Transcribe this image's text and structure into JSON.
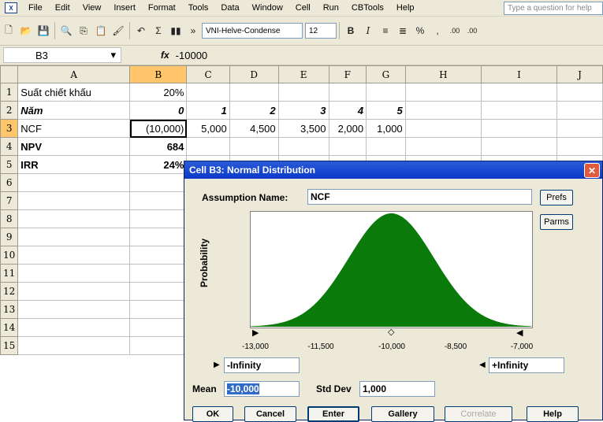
{
  "menubar": {
    "items": [
      "File",
      "Edit",
      "View",
      "Insert",
      "Format",
      "Tools",
      "Data",
      "Window",
      "Cell",
      "Run",
      "CBTools",
      "Help"
    ],
    "ask_placeholder": "Type a question for help"
  },
  "toolbar": {
    "font_name": "VNI-Helve-Condense",
    "font_size": "12",
    "bold": "B",
    "italic": "I",
    "percent": "%",
    "comma": ",",
    "inc_decimal": ".00",
    "dec_decimal": ".00"
  },
  "formula_bar": {
    "name_box": "B3",
    "fx": "fx",
    "value": "-10000"
  },
  "sheet": {
    "columns": [
      "A",
      "B",
      "C",
      "D",
      "E",
      "F",
      "G",
      "H",
      "I",
      "J"
    ],
    "rows": [
      {
        "n": "1",
        "cells": [
          "Suất chiết khấu",
          "20%",
          "",
          "",
          "",
          "",
          "",
          "",
          "",
          ""
        ]
      },
      {
        "n": "2",
        "cells": [
          "Năm",
          "0",
          "1",
          "2",
          "3",
          "4",
          "5",
          "",
          "",
          ""
        ]
      },
      {
        "n": "3",
        "cells": [
          "NCF",
          "(10,000)",
          "5,000",
          "4,500",
          "3,500",
          "2,000",
          "1,000",
          "",
          "",
          ""
        ]
      },
      {
        "n": "4",
        "cells": [
          "NPV",
          "684",
          "",
          "",
          "",
          "",
          "",
          "",
          "",
          ""
        ]
      },
      {
        "n": "5",
        "cells": [
          "IRR",
          "24%",
          "",
          "",
          "",
          "",
          "",
          "",
          "",
          ""
        ]
      },
      {
        "n": "6",
        "cells": [
          "",
          "",
          "",
          "",
          "",
          "",
          "",
          "",
          "",
          ""
        ]
      },
      {
        "n": "7",
        "cells": [
          "",
          "",
          "",
          "",
          "",
          "",
          "",
          "",
          "",
          ""
        ]
      },
      {
        "n": "8",
        "cells": [
          "",
          "",
          "",
          "",
          "",
          "",
          "",
          "",
          "",
          ""
        ]
      },
      {
        "n": "9",
        "cells": [
          "",
          "",
          "",
          "",
          "",
          "",
          "",
          "",
          "",
          ""
        ]
      },
      {
        "n": "10",
        "cells": [
          "",
          "",
          "",
          "",
          "",
          "",
          "",
          "",
          "",
          ""
        ]
      },
      {
        "n": "11",
        "cells": [
          "",
          "",
          "",
          "",
          "",
          "",
          "",
          "",
          "",
          ""
        ]
      },
      {
        "n": "12",
        "cells": [
          "",
          "",
          "",
          "",
          "",
          "",
          "",
          "",
          "",
          ""
        ]
      },
      {
        "n": "13",
        "cells": [
          "",
          "",
          "",
          "",
          "",
          "",
          "",
          "",
          "",
          ""
        ]
      },
      {
        "n": "14",
        "cells": [
          "",
          "",
          "",
          "",
          "",
          "",
          "",
          "",
          "",
          ""
        ]
      },
      {
        "n": "15",
        "cells": [
          "",
          "",
          "",
          "",
          "",
          "",
          "",
          "",
          "",
          ""
        ]
      }
    ]
  },
  "dialog": {
    "title": "Cell B3: Normal Distribution",
    "close": "✕",
    "assumption_label": "Assumption Name:",
    "assumption_value": "NCF",
    "prefs": "Prefs",
    "parms": "Parms",
    "y_label": "Probability",
    "ticks": [
      "-13,000",
      "-11,500",
      "-10,000",
      "-8,500",
      "-7,000"
    ],
    "lower_bound": "-Infinity",
    "upper_bound": "+Infinity",
    "mean_label": "Mean",
    "mean_value": "-10,000",
    "std_label": "Std Dev",
    "std_value": "1,000",
    "buttons": [
      "OK",
      "Cancel",
      "Enter",
      "Gallery",
      "Correlate",
      "Help"
    ],
    "fill_color": "#0a7a0a",
    "mean": -10000,
    "std_dev": 1000
  }
}
